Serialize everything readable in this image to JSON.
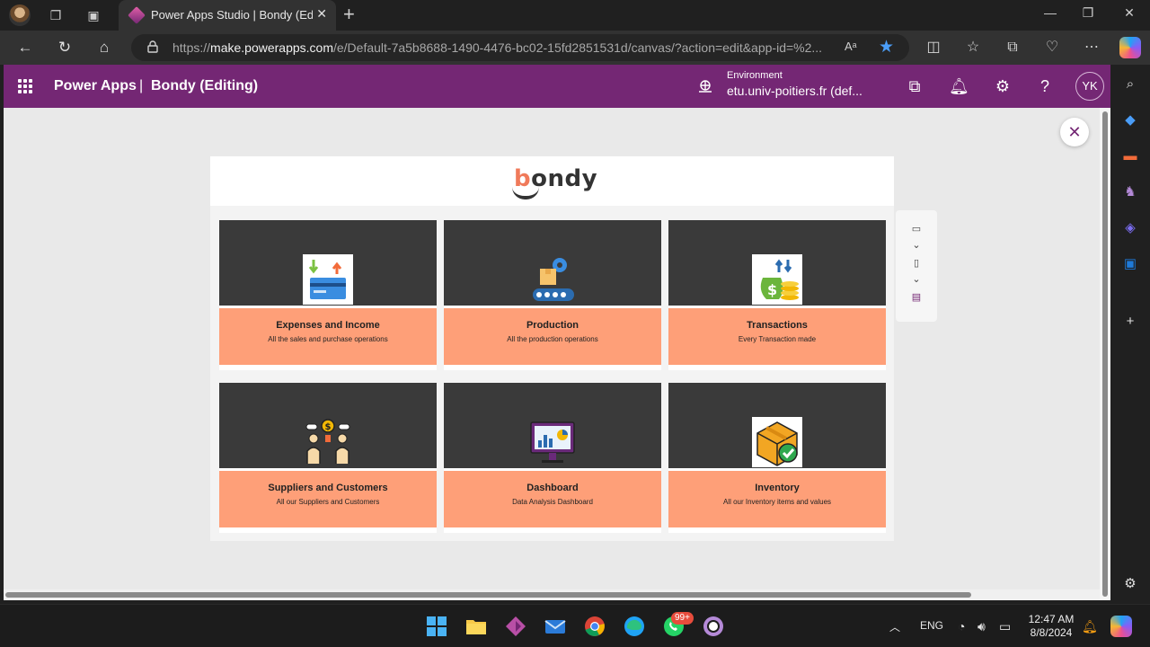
{
  "browser": {
    "tab_title": "Power Apps Studio | Bondy (Editing)",
    "tab_title_short": "Power Apps Studio  |  Bondy (Edi",
    "url_prefix": "https://",
    "url_domain": "make.powerapps.com",
    "url_rest": "/e/Default-7a5b8688-1490-4476-bc02-15fd2851531d/canvas/?action=edit&app-id=%2...",
    "read_aloud_label": "A",
    "accent_color": "#4a9df8"
  },
  "header": {
    "app_name": "Power Apps",
    "separator": "|",
    "document_title": "Bondy (Editing)",
    "environment_label": "Environment",
    "environment_value": "etu.univ-poitiers.fr (def...",
    "user_initials": "YK",
    "brand_color": "#742774"
  },
  "app": {
    "logo_text_first": "b",
    "logo_text_rest": "ondy",
    "cards": [
      {
        "title": "Expenses and Income",
        "subtitle": "All the sales and purchase operations",
        "icon": "credit-card-transfer-icon"
      },
      {
        "title": "Production",
        "subtitle": "All the production operations",
        "icon": "conveyor-gear-icon"
      },
      {
        "title": "Transactions",
        "subtitle": "Every Transaction made",
        "icon": "money-bag-coins-icon"
      },
      {
        "title": "Suppliers and Customers",
        "subtitle": "All our Suppliers and Customers",
        "icon": "people-dollar-icon"
      },
      {
        "title": "Dashboard",
        "subtitle": "Data Analysis Dashboard",
        "icon": "monitor-chart-icon"
      },
      {
        "title": "Inventory",
        "subtitle": "All our Inventory items and values",
        "icon": "box-check-icon"
      }
    ],
    "card_top_color": "#3a3a3a",
    "card_bottom_color": "#fe9f78"
  },
  "taskbar": {
    "whatsapp_badge": "99+",
    "language": "ENG",
    "time": "12:47 AM",
    "date": "8/8/2024"
  }
}
